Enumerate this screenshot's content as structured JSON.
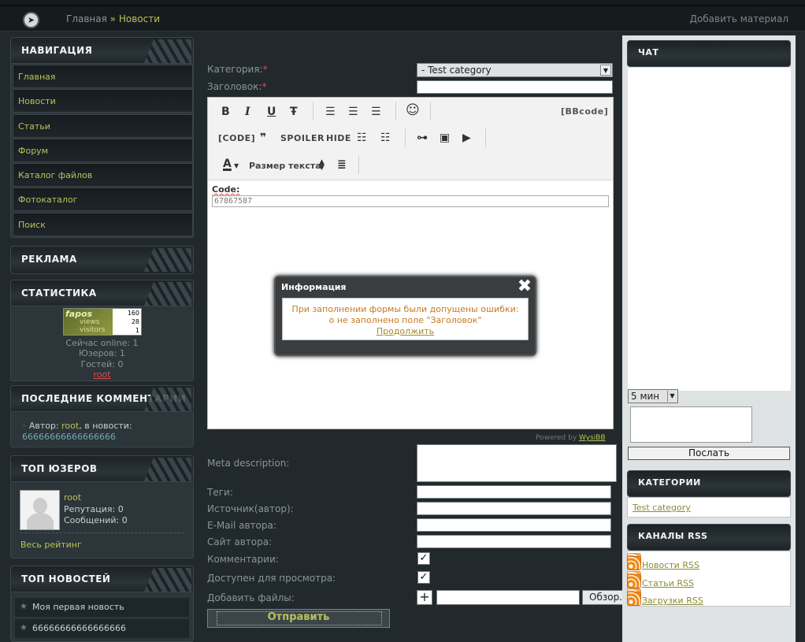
{
  "topbar": {
    "breadcrumb_home": "Главная",
    "breadcrumb_sep": "»",
    "breadcrumb_current": "Новости",
    "add_material": "Добавить материал"
  },
  "left": {
    "nav_title": "НАВИГАЦИЯ",
    "nav_items": [
      "Главная",
      "Новости",
      "Статьи",
      "Форум",
      "Каталог файлов",
      "Фотокаталог",
      "Поиск"
    ],
    "ads_title": "РЕКЛАМА",
    "stats_title": "СТАТИСТИКА",
    "counter": {
      "brand": "fapos",
      "views_label": "views",
      "visitors_label": "visitors",
      "n1": "160",
      "n2": "28",
      "n3": "1"
    },
    "online": "Сейчас online: 1",
    "users": "Юзеров: 1",
    "guests": "Гостей: 0",
    "user_link": "root",
    "comments_title": "ПОСЛЕДНИЕ КОММЕНТАРИИ",
    "comment": {
      "bullet": "◦",
      "prefix": "Автор: ",
      "author": "root",
      "mid": ", в новости:",
      "news": "66666666666666666"
    },
    "top_users_title": "ТОП ЮЗЕРОВ",
    "top_user": {
      "name": "root",
      "reputation": "Репутация: 0",
      "messages": "Сообщений: 0"
    },
    "all_rating": "Весь рейтинг",
    "top_news_title": "ТОП НОВОСТЕЙ",
    "top_news": [
      "Моя первая новость",
      "66666666666666666"
    ]
  },
  "form": {
    "category_label": "Категория:",
    "required": "*",
    "category_value": "- Test category",
    "title_label": "Заголовок:",
    "toolbar": {
      "bold": "B",
      "italic": "I",
      "underline": "U",
      "strike": "Ŧ",
      "code": "[CODE]",
      "quote": "❞",
      "spoiler": "SPOILER",
      "hide": "HIDE",
      "bbcode": "[BBcode]",
      "fontsize": "Размер текста"
    },
    "code_label": "Code:",
    "code_value": "67867587",
    "powered_prefix": "Powered by ",
    "powered_link": "WysiBB",
    "meta_label": "Meta description:",
    "tags_label": "Теги:",
    "source_label": "Источник(автор):",
    "email_label": "E-Mail автора:",
    "site_label": "Сайт автора:",
    "comments_label": "Комментарии:",
    "access_label": "Доступен для просмотра:",
    "files_label": "Добавить файлы:",
    "plus": "+",
    "browse": "Обзор...",
    "submit": "Отправить"
  },
  "modal": {
    "title": "Информация",
    "close": "✖",
    "line1": "При заполнении формы были допущены ошибки:",
    "line2": "о  не заполнено поле \"Заголовок\"",
    "continue": "Продолжить"
  },
  "right": {
    "chat_title": "ЧАТ",
    "chat_interval": "5 мин",
    "chat_send": "Послать",
    "categories_title": "КАТЕГОРИИ",
    "category_link": "Test category",
    "rss_title": "КАНАЛЫ RSS",
    "rss": [
      "Новости RSS",
      "Статьи RSS",
      "Загрузки RSS"
    ]
  },
  "colors": {
    "accent": "#b9c35a",
    "error": "#e04b4b",
    "bg": "#22292d"
  }
}
